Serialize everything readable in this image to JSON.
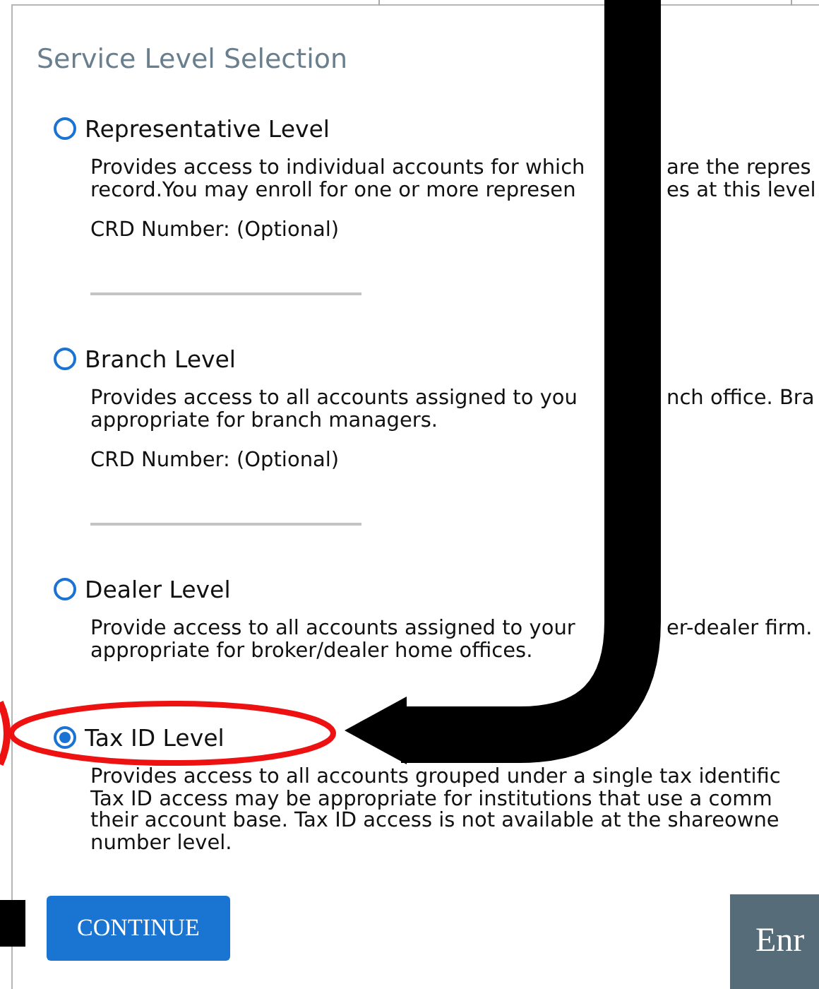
{
  "title": "Service Level Selection",
  "options": [
    {
      "label": "Representative Level",
      "selected": false,
      "description": [
        [
          "Provides access to individual accounts for which",
          "are the repres"
        ],
        [
          "record.You may enroll for one or more represen",
          "es at this level"
        ]
      ],
      "field_label": "CRD Number: (Optional)"
    },
    {
      "label": "Branch Level",
      "selected": false,
      "description": [
        [
          "Provides access to all accounts assigned to you",
          "nch office. Bra"
        ],
        [
          "appropriate for branch managers."
        ]
      ],
      "field_label": "CRD Number: (Optional)"
    },
    {
      "label": "Dealer Level",
      "selected": false,
      "description": [
        [
          "Provide access to all accounts assigned to your",
          "er-dealer firm."
        ],
        [
          "appropriate for broker/dealer home offices."
        ]
      ]
    },
    {
      "label": "Tax ID Level",
      "selected": true,
      "description": [
        [
          "Provides access to all accounts grouped under a single tax identific"
        ],
        [
          "Tax ID access may be appropriate for institutions that use a comm"
        ],
        [
          "their account base. Tax ID access is not available at the shareowne"
        ],
        [
          "number level."
        ]
      ]
    }
  ],
  "buttons": [
    {
      "kind": "primary",
      "label": "CONTINUE"
    },
    {
      "kind": "secondary",
      "label": "Enr"
    }
  ]
}
